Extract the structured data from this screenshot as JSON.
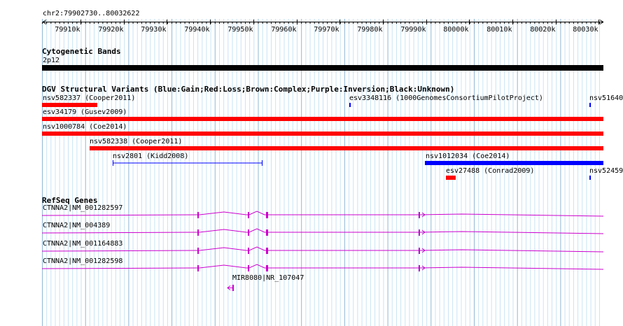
{
  "ruler": {
    "coordinates": "chr2:79902730..80032622",
    "ticks": [
      "79910k",
      "79920k",
      "79930k",
      "79940k",
      "79950k",
      "79960k",
      "79970k",
      "79980k",
      "79990k",
      "80000k",
      "80010k",
      "80020k",
      "80030k"
    ]
  },
  "cytobands": {
    "title": "Cytogenetic Bands",
    "band_label": "2p12"
  },
  "dgv": {
    "title": "DGV Structural Variants (Blue:Gain;Red:Loss;Brown:Complex;Purple:Inversion;Black:Unknown)",
    "features": [
      {
        "label": "nsv582337 (Cooper2011)",
        "color": "#ff0000",
        "kind": "loss"
      },
      {
        "label": "esv3348116 (1000GenomesConsortiumPilotProject)",
        "color": "#0000ff",
        "kind": "gain"
      },
      {
        "label": "nsv51640",
        "color": "#0000ff",
        "kind": "gain"
      },
      {
        "label": "esv34179 (Gusev2009)",
        "color": "#ff0000",
        "kind": "loss"
      },
      {
        "label": "nsv1000784 (Coe2014)",
        "color": "#ff0000",
        "kind": "loss"
      },
      {
        "label": "nsv582338 (Cooper2011)",
        "color": "#ff0000",
        "kind": "loss"
      },
      {
        "label": "nsv2801 (Kidd2008)",
        "color": "#0000ff",
        "kind": "gain"
      },
      {
        "label": "nsv1012034 (Coe2014)",
        "color": "#0000ff",
        "kind": "gain"
      },
      {
        "label": "esv27488 (Conrad2009)",
        "color": "#ff0000",
        "kind": "loss"
      },
      {
        "label": "nsv52459",
        "color": "#0000ff",
        "kind": "gain"
      }
    ]
  },
  "refseq": {
    "title": "RefSeq Genes",
    "gene_color": "#cc00cc",
    "genes": [
      {
        "label": "CTNNA2|NM_001282597"
      },
      {
        "label": "CTNNA2|NM_004389"
      },
      {
        "label": "CTNNA2|NM_001164883"
      },
      {
        "label": "CTNNA2|NM_001282598"
      },
      {
        "label": "MIR8080|NR_107047"
      }
    ]
  },
  "colors": {
    "grid_light": "#c8e4f4",
    "grid_dark": "#8fb8d6",
    "band": "#000000"
  }
}
